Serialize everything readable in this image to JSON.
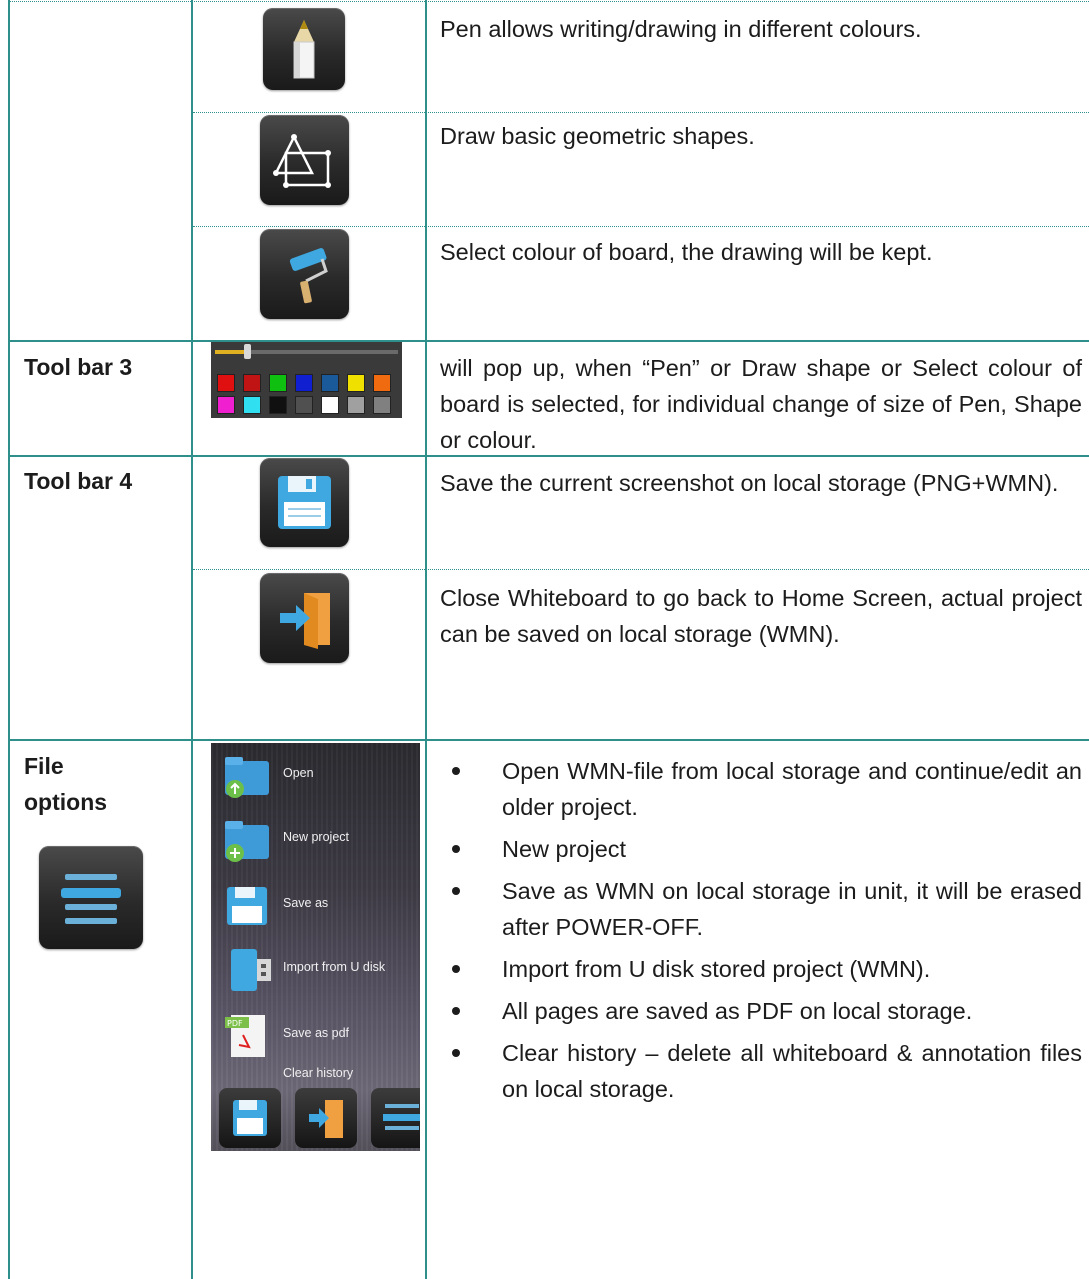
{
  "rows": {
    "pen": {
      "description": "Pen allows writing/drawing in different colours.",
      "icon": "pencil-icon"
    },
    "shapes": {
      "description": "Draw basic geometric shapes.",
      "icon": "shapes-icon"
    },
    "board_colour": {
      "description": "Select colour of board, the drawing will be kept.",
      "icon": "paint-roller-icon"
    },
    "toolbar3": {
      "label": "Tool bar 3",
      "description": "will pop up, when “Pen” or Draw shape or Select colour of board is selected, for individual change of size of Pen, Shape or colour.",
      "icon": "size-colour-palette-icon",
      "palette_colors": [
        "#e01010",
        "#c01414",
        "#10c010",
        "#1020d0",
        "#1a5a9a",
        "#f0e000",
        "#f06a10",
        "#f020d0",
        "#30e0f0",
        "#101010",
        "#505050",
        "#ffffff",
        "#a0a0a0",
        "#808080"
      ]
    },
    "toolbar4": {
      "label": "Tool bar 4",
      "save": {
        "description": "Save the current screenshot on local storage (PNG+WMN).",
        "icon": "floppy-disk-icon"
      },
      "close": {
        "description": "Close Whiteboard to go back to Home Screen, actual project can be saved on local storage (WMN).",
        "icon": "exit-door-icon"
      }
    },
    "file_options": {
      "label_line1": "File",
      "label_line2": "options",
      "icon": "menu-list-icon",
      "menu_items": [
        "Open",
        "New project",
        "Save as",
        "Import from U disk",
        "Save as pdf",
        "Clear history"
      ],
      "bullets": [
        "Open WMN-file from local storage and continue/edit an older project.",
        "New project",
        "Save as WMN on local storage in unit, it will be erased after POWER-OFF.",
        "Import from U disk stored project (WMN).",
        "All pages are saved as PDF on local storage.",
        "Clear history – delete all whiteboard & annotation files on local storage."
      ]
    }
  },
  "colors": {
    "border": "#2f8f8a",
    "text": "#1c1c1c"
  }
}
